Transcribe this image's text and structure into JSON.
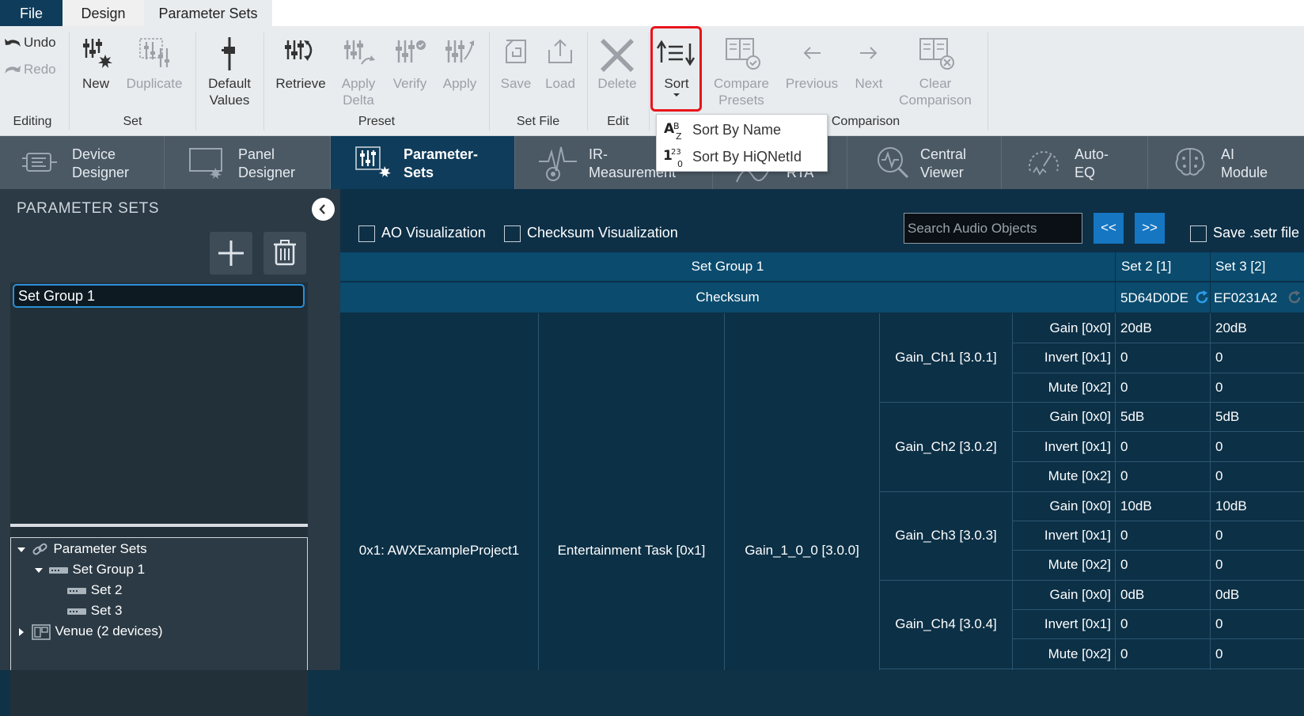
{
  "menu": {
    "file": "File",
    "design": "Design",
    "parameter_sets": "Parameter Sets"
  },
  "ribbon": {
    "editing": {
      "undo": "Undo",
      "redo": "Redo",
      "label": "Editing"
    },
    "set": {
      "new": "New",
      "duplicate": "Duplicate",
      "label": "Set"
    },
    "default_values": [
      "Default",
      "Values"
    ],
    "preset": {
      "retrieve": "Retrieve",
      "apply_delta": [
        "Apply",
        "Delta"
      ],
      "verify": "Verify",
      "apply": "Apply",
      "label": "Preset"
    },
    "set_file": {
      "save": "Save",
      "load": "Load",
      "label": "Set File"
    },
    "edit": {
      "delete": "Delete",
      "label": "Edit"
    },
    "sort": {
      "label": "Sort"
    },
    "comparison": {
      "compare": [
        "Compare",
        "Presets"
      ],
      "previous": "Previous",
      "next": "Next",
      "clear": [
        "Clear",
        "Comparison"
      ],
      "label": "Comparison"
    }
  },
  "sort_menu": [
    {
      "label": "Sort By Name",
      "icon": "sort-az-icon"
    },
    {
      "label": "Sort By HiQNetId",
      "icon": "sort-123-icon"
    }
  ],
  "module_tabs": [
    {
      "line1": "Device",
      "line2": "Designer"
    },
    {
      "line1": "Panel",
      "line2": "Designer"
    },
    {
      "line1": "Parameter-",
      "line2": "Sets"
    },
    {
      "line1": "IR-",
      "line2": "Measurement"
    },
    {
      "line1": "",
      "line2": "RTA"
    },
    {
      "line1": "Central",
      "line2": "Viewer"
    },
    {
      "line1": "Auto-",
      "line2": "EQ"
    },
    {
      "line1": "AI",
      "line2": "Module"
    }
  ],
  "left_panel": {
    "title": "PARAMETER SETS",
    "set_group_value": "Set Group 1",
    "tree": {
      "root": "Parameter Sets",
      "group": "Set Group 1",
      "sets": [
        "Set 2",
        "Set 3"
      ],
      "venue": "Venue (2 devices)"
    }
  },
  "toolbar": {
    "ao_visualization": "AO Visualization",
    "checksum_visualization": "Checksum Visualization",
    "search_placeholder": "Search Audio Objects",
    "prev": "<<",
    "next": ">>",
    "save_setr": "Save .setr file"
  },
  "table": {
    "group_header": "Set Group 1",
    "checksum_header": "Checksum",
    "sets": [
      {
        "name": "Set 2 [1]",
        "checksum": "5D64D0DE"
      },
      {
        "name": "Set 3 [2]",
        "checksum": "EF0231A2"
      }
    ],
    "project": "0x1: AWXExampleProject1",
    "task": "Entertainment Task [0x1]",
    "object": "Gain_1_0_0 [3.0.0]",
    "channels": [
      {
        "name": "Gain_Ch1 [3.0.1]",
        "params": [
          {
            "name": "Gain [0x0]",
            "values": [
              "20dB",
              "20dB"
            ]
          },
          {
            "name": "Invert [0x1]",
            "values": [
              "0",
              "0"
            ]
          },
          {
            "name": "Mute [0x2]",
            "values": [
              "0",
              "0"
            ]
          }
        ]
      },
      {
        "name": "Gain_Ch2 [3.0.2]",
        "params": [
          {
            "name": "Gain [0x0]",
            "values": [
              "5dB",
              "5dB"
            ]
          },
          {
            "name": "Invert [0x1]",
            "values": [
              "0",
              "0"
            ]
          },
          {
            "name": "Mute [0x2]",
            "values": [
              "0",
              "0"
            ]
          }
        ]
      },
      {
        "name": "Gain_Ch3 [3.0.3]",
        "params": [
          {
            "name": "Gain [0x0]",
            "values": [
              "10dB",
              "10dB"
            ]
          },
          {
            "name": "Invert [0x1]",
            "values": [
              "0",
              "0"
            ]
          },
          {
            "name": "Mute [0x2]",
            "values": [
              "0",
              "0"
            ]
          }
        ]
      },
      {
        "name": "Gain_Ch4 [3.0.4]",
        "params": [
          {
            "name": "Gain [0x0]",
            "values": [
              "0dB",
              "0dB"
            ]
          },
          {
            "name": "Invert [0x1]",
            "values": [
              "0",
              "0"
            ]
          },
          {
            "name": "Mute [0x2]",
            "values": [
              "0",
              "0"
            ]
          }
        ]
      }
    ]
  }
}
